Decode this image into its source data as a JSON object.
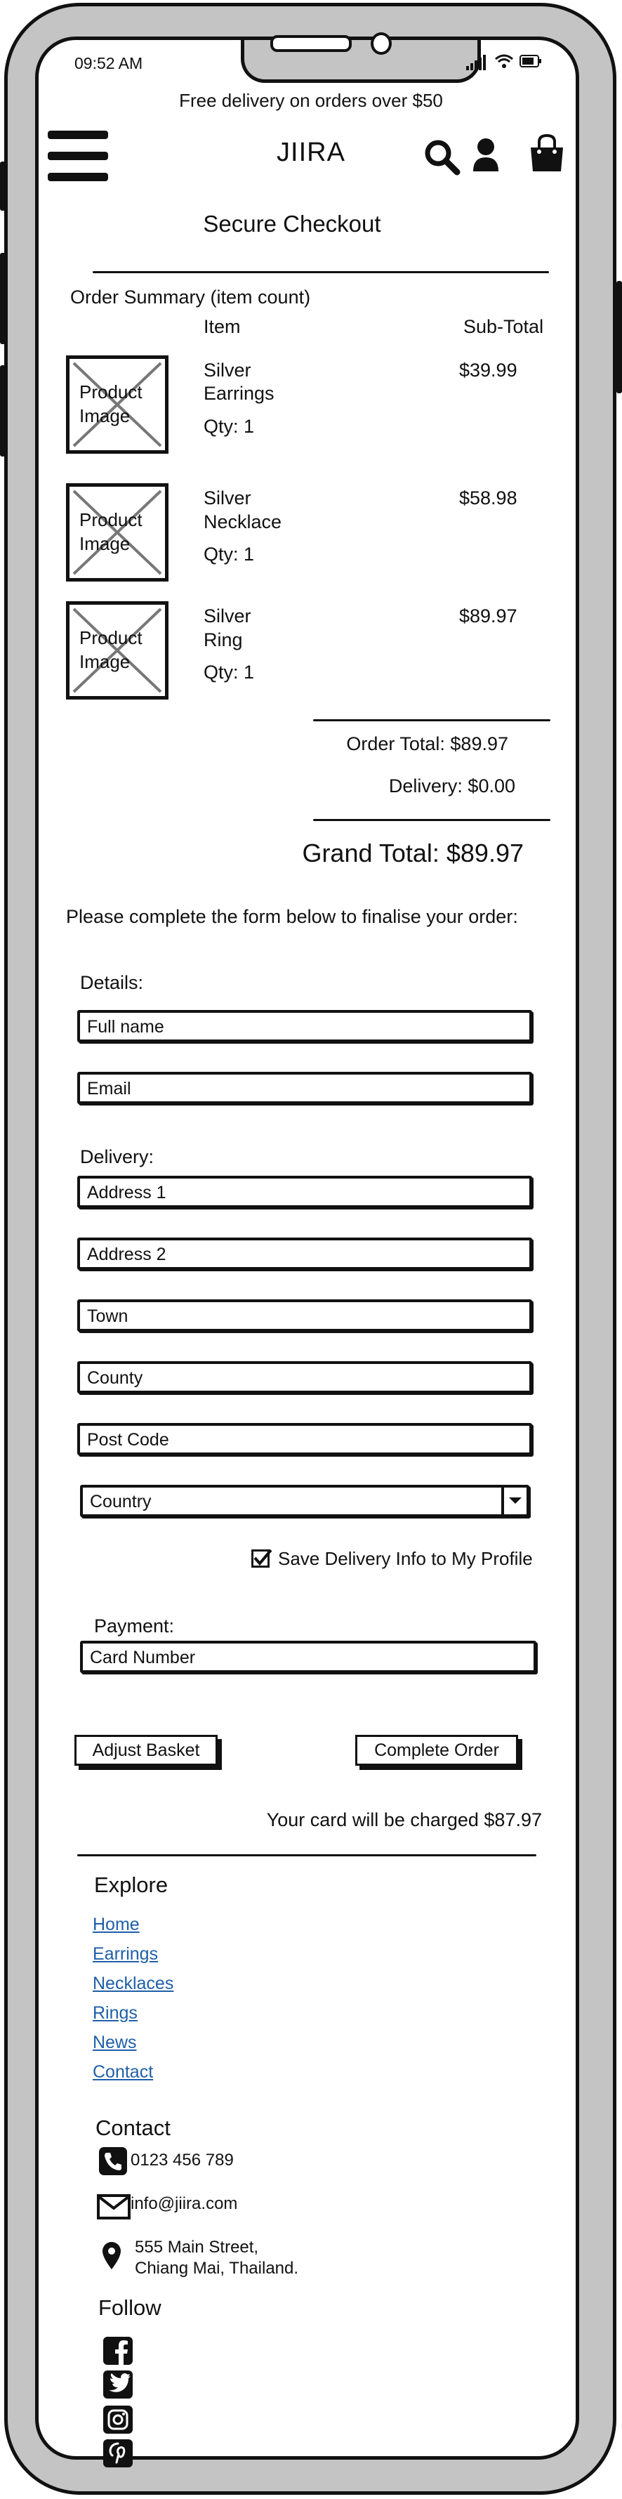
{
  "status_bar": {
    "time": "09:52 AM"
  },
  "promo_banner": "Free delivery on orders over $50",
  "brand": "JIIRA",
  "page_title": "Secure Checkout",
  "summary": {
    "heading": "Order Summary (item count)",
    "col_item": "Item",
    "col_subtotal": "Sub-Total",
    "image_placeholder": "Product Image",
    "items": [
      {
        "name_line1": "Silver",
        "name_line2": "Earrings",
        "qty": "Qty: 1",
        "price": "$39.99"
      },
      {
        "name_line1": "Silver",
        "name_line2": "Necklace",
        "qty": "Qty: 1",
        "price": "$58.98"
      },
      {
        "name_line1": "Silver",
        "name_line2": "Ring",
        "qty": "Qty: 1",
        "price": "$89.97"
      }
    ],
    "order_total": "Order Total: $89.97",
    "delivery": "Delivery: $0.00",
    "grand_total": "Grand Total: $89.97"
  },
  "form": {
    "intro": "Please complete the form below to finalise your order:",
    "details_label": "Details:",
    "full_name": "Full name",
    "email": "Email",
    "delivery_label": "Delivery:",
    "address1": "Address 1",
    "address2": "Address 2",
    "town": "Town",
    "county": "County",
    "post_code": "Post Code",
    "country": "Country",
    "save_info": "Save Delivery Info to My Profile",
    "save_info_checked": true,
    "payment_label": "Payment:",
    "card_number": "Card Number",
    "adjust_basket": "Adjust Basket",
    "complete_order": "Complete Order",
    "charge_note": "Your card will be charged $87.97"
  },
  "footer": {
    "explore_heading": "Explore",
    "links": [
      "Home",
      "Earrings",
      "Necklaces",
      "Rings",
      "News",
      "Contact"
    ],
    "contact_heading": "Contact",
    "phone": "0123 456 789",
    "email": "info@jiira.com",
    "address_line1": "555 Main Street,",
    "address_line2": "Chiang Mai, Thailand.",
    "follow_heading": "Follow",
    "social_icons": [
      "facebook-icon",
      "twitter-icon",
      "instagram-icon",
      "pinterest-icon"
    ]
  }
}
